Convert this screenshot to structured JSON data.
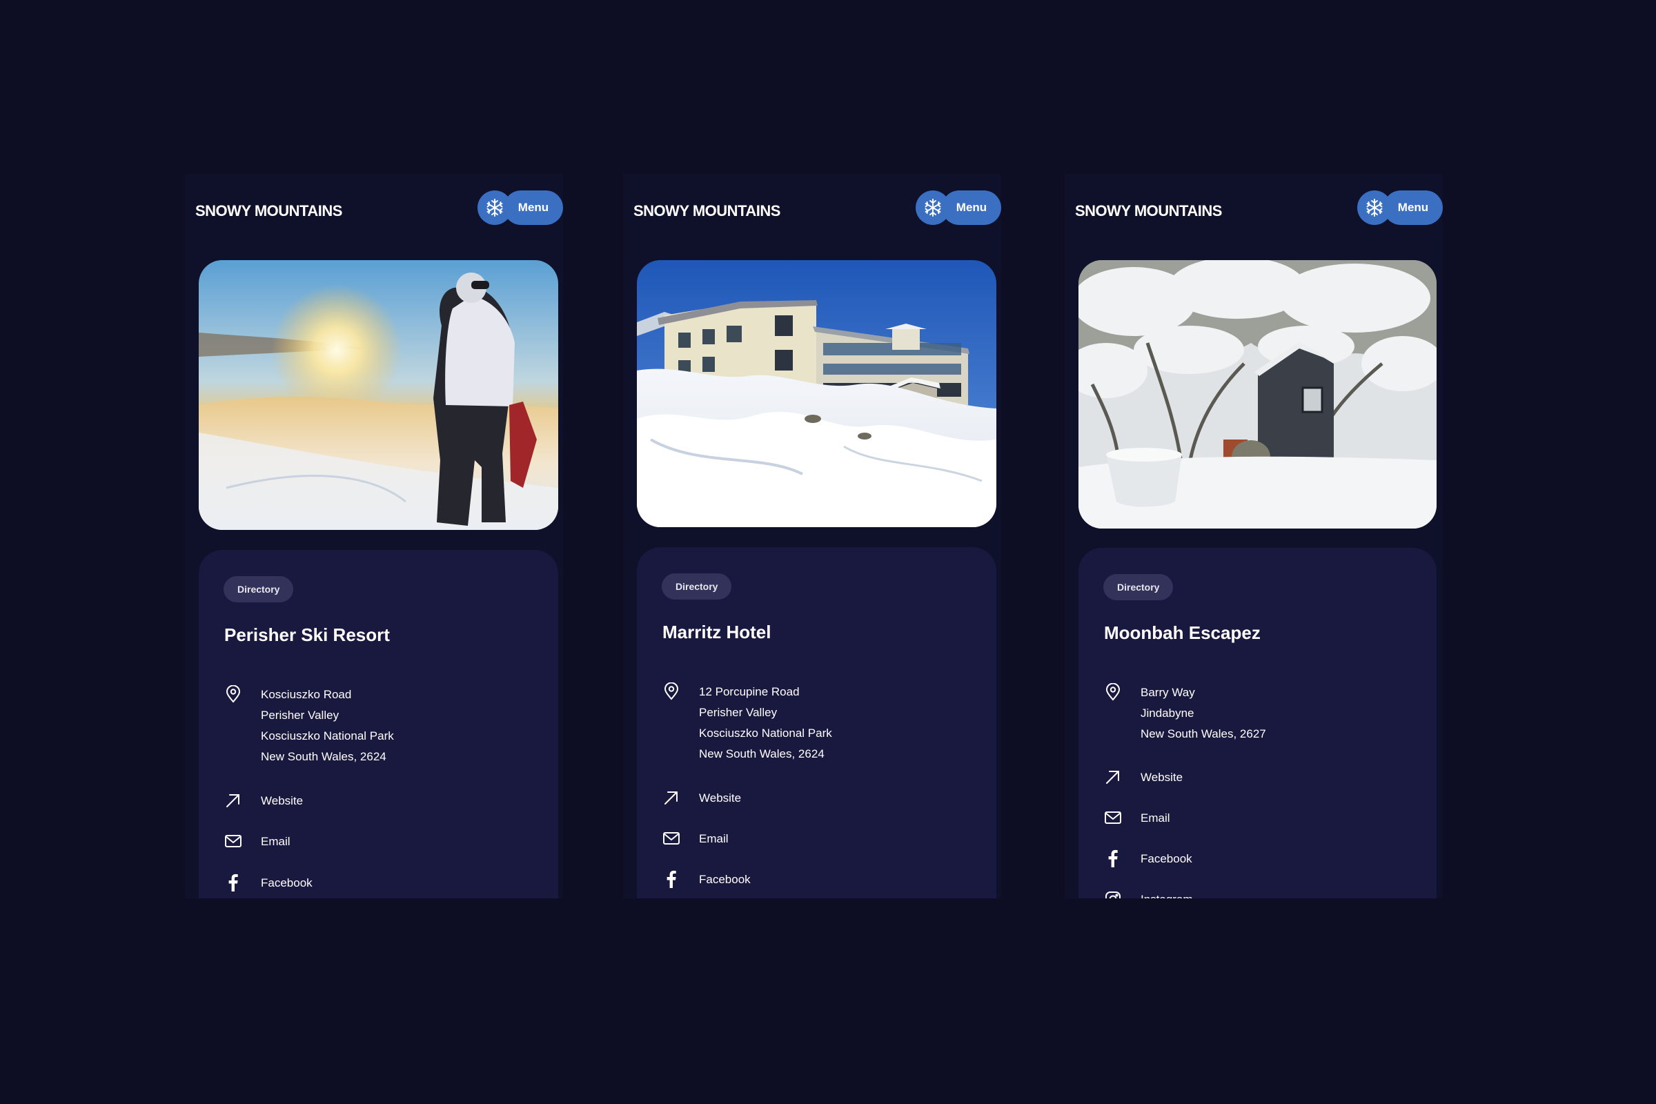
{
  "colors": {
    "page_background": "#0d0e24",
    "accent_button": "#3a6fc2",
    "card_background": "#19183f",
    "tag_background": "#33325a"
  },
  "screens": [
    {
      "header": {
        "brand": "SNOWY MOUNTAINS",
        "menu_label": "Menu",
        "snow_icon": "snowflake-icon"
      },
      "photo_subject": "snowboarder-sunset",
      "listing": {
        "tag": "Directory",
        "title": "Perisher Ski Resort",
        "address_lines": [
          "Kosciuszko Road",
          "Perisher Valley",
          "Kosciuszko National Park",
          "New South Wales, 2624"
        ],
        "links": [
          {
            "label": "Website",
            "icon": "arrow-up-right-icon"
          },
          {
            "label": "Email",
            "icon": "envelope-icon"
          },
          {
            "label": "Facebook",
            "icon": "facebook-icon"
          }
        ]
      }
    },
    {
      "header": {
        "brand": "SNOWY MOUNTAINS",
        "menu_label": "Menu",
        "snow_icon": "snowflake-icon"
      },
      "photo_subject": "hotel-in-snow",
      "listing": {
        "tag": "Directory",
        "title": "Marritz Hotel",
        "address_lines": [
          "12 Porcupine Road",
          "Perisher Valley",
          "Kosciuszko National Park",
          "New South Wales, 2624"
        ],
        "links": [
          {
            "label": "Website",
            "icon": "arrow-up-right-icon"
          },
          {
            "label": "Email",
            "icon": "envelope-icon"
          },
          {
            "label": "Facebook",
            "icon": "facebook-icon"
          }
        ]
      }
    },
    {
      "header": {
        "brand": "SNOWY MOUNTAINS",
        "menu_label": "Menu",
        "snow_icon": "snowflake-icon"
      },
      "photo_subject": "cabin-snowy-trees",
      "listing": {
        "tag": "Directory",
        "title": "Moonbah Escapez",
        "address_lines": [
          "Barry Way",
          "Jindabyne",
          "New South Wales, 2627"
        ],
        "links": [
          {
            "label": "Website",
            "icon": "arrow-up-right-icon"
          },
          {
            "label": "Email",
            "icon": "envelope-icon"
          },
          {
            "label": "Facebook",
            "icon": "facebook-icon"
          },
          {
            "label": "Instagram",
            "icon": "instagram-icon"
          }
        ]
      }
    }
  ]
}
